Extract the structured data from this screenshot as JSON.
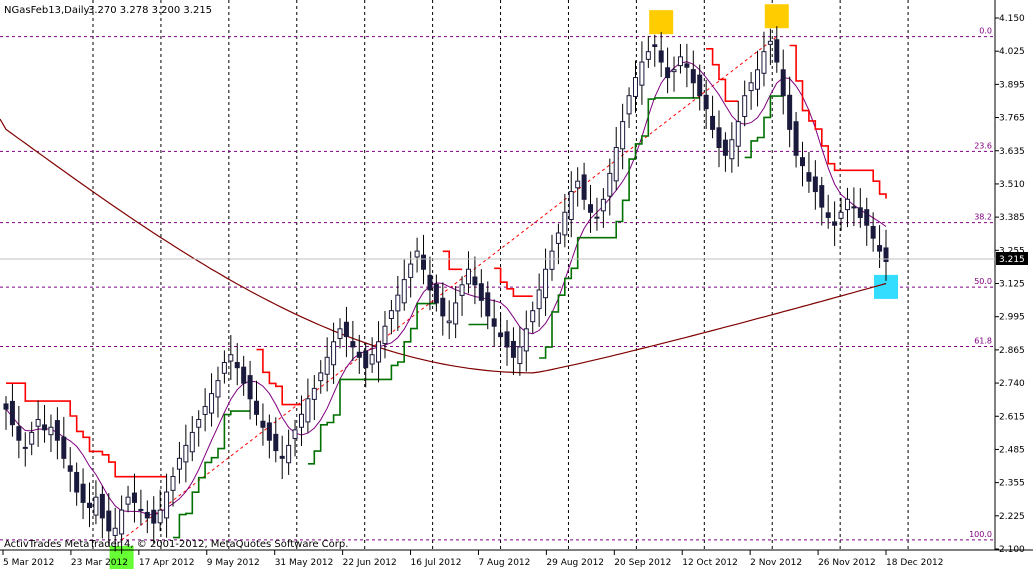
{
  "chart_data": {
    "type": "candlestick",
    "header": {
      "symbol": "NGasFeb13,Daily",
      "ohlc": "3.270 3.278 3.200 3.215"
    },
    "copyright": "ActivTrades MetaTrader 4, © 2001-2012, MetaQuotes Software Corp.",
    "current_price": "3.215",
    "y_ticks": [
      "4.150",
      "4.025",
      "3.895",
      "3.765",
      "3.635",
      "3.510",
      "3.385",
      "3.255",
      "3.125",
      "2.995",
      "2.865",
      "2.740",
      "2.615",
      "2.485",
      "2.355",
      "2.225",
      "2.100"
    ],
    "ylim": [
      2.1,
      4.15
    ],
    "x_ticks": [
      "5 Mar 2012",
      "23 Mar 2012",
      "17 Apr 2012",
      "9 May 2012",
      "31 May 2012",
      "22 Jun 2012",
      "16 Jul 2012",
      "7 Aug 2012",
      "29 Aug 2012",
      "20 Sep 2012",
      "12 Oct 2012",
      "2 Nov 2012",
      "26 Nov 2012",
      "18 Dec 2012"
    ],
    "grid": true,
    "fibonacci": {
      "levels": [
        {
          "label": "0.0",
          "price": 4.078
        },
        {
          "label": "23.6",
          "price": 3.635
        },
        {
          "label": "38.2",
          "price": 3.36
        },
        {
          "label": "50.0",
          "price": 3.111
        },
        {
          "label": "61.8",
          "price": 2.882
        },
        {
          "label": "100.0",
          "price": 2.135
        }
      ],
      "color": "#800080"
    },
    "series": [
      {
        "name": "",
        "role": "price",
        "values": [
          2.64,
          2.58,
          2.52,
          2.49,
          2.55,
          2.6,
          2.56,
          2.57,
          2.52,
          2.45,
          2.4,
          2.32,
          2.28,
          2.26,
          2.3,
          2.22,
          2.17,
          2.18,
          2.25,
          2.3,
          2.28,
          2.25,
          2.22,
          2.2,
          2.25,
          2.32,
          2.38,
          2.45,
          2.5,
          2.55,
          2.6,
          2.65,
          2.7,
          2.75,
          2.82,
          2.85,
          2.8,
          2.74,
          2.68,
          2.62,
          2.57,
          2.52,
          2.48,
          2.45,
          2.5,
          2.56,
          2.62,
          2.68,
          2.72,
          2.78,
          2.84,
          2.9,
          2.95,
          2.92,
          2.88,
          2.84,
          2.8,
          2.85,
          2.9,
          2.96,
          3.02,
          3.08,
          3.14,
          3.2,
          3.25,
          3.18,
          3.1,
          3.05,
          3.0,
          2.98,
          3.05,
          3.12,
          3.18,
          3.12,
          3.06,
          3.0,
          2.96,
          2.92,
          2.88,
          2.84,
          2.88,
          2.95,
          3.02,
          3.1,
          3.18,
          3.25,
          3.32,
          3.4,
          3.48,
          3.52,
          3.45,
          3.4,
          3.38,
          3.45,
          3.55,
          3.65,
          3.75,
          3.85,
          3.92,
          3.98,
          4.02,
          4.04,
          3.98,
          3.92,
          3.95,
          4.0,
          3.96,
          3.9,
          3.85,
          3.8,
          3.72,
          3.65,
          3.62,
          3.68,
          3.75,
          3.85,
          3.9,
          3.95,
          4.02,
          4.06,
          3.98,
          3.85,
          3.72,
          3.62,
          3.58,
          3.52,
          3.48,
          3.42,
          3.38,
          3.35,
          3.4,
          3.45,
          3.42,
          3.38,
          3.35,
          3.3,
          3.25,
          3.21
        ],
        "color": "#1a1a3c"
      },
      {
        "name": "",
        "role": "ma200",
        "color": "#800000"
      },
      {
        "name": "",
        "role": "ma_fast",
        "color": "#800080"
      },
      {
        "name": "",
        "role": "stop_upper",
        "color": "#ff0000"
      },
      {
        "name": "",
        "role": "stop_lower",
        "color": "#007000"
      }
    ],
    "markers": [
      {
        "kind": "low-box",
        "color": "#66ff33"
      },
      {
        "kind": "high-box",
        "color": "#ffcc00"
      },
      {
        "kind": "high-box",
        "color": "#ffcc00"
      },
      {
        "kind": "current-box",
        "color": "#33ddff"
      }
    ]
  }
}
